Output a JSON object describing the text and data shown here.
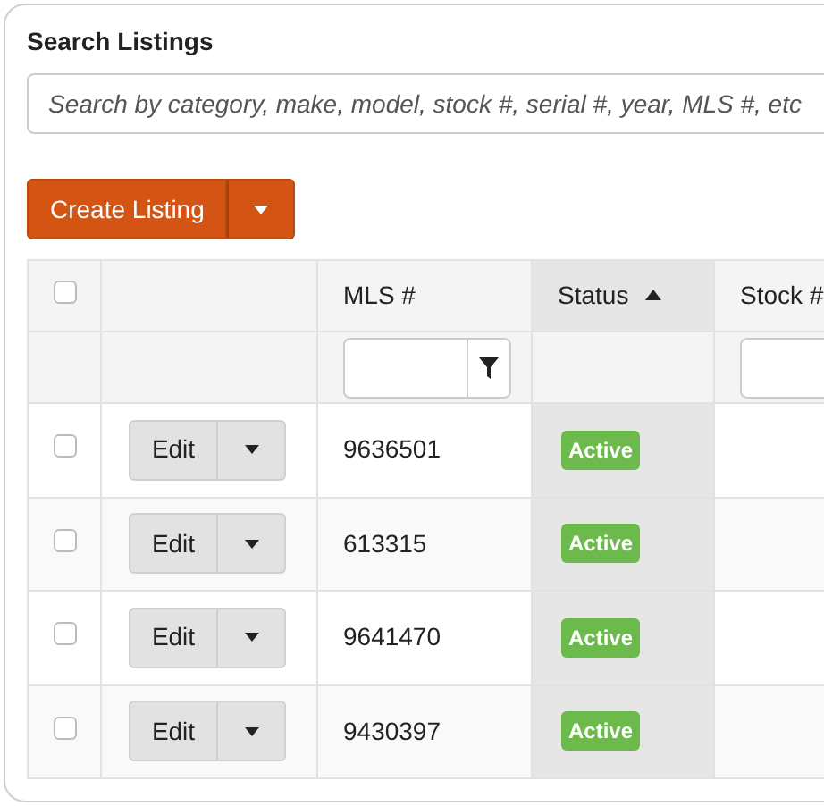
{
  "search": {
    "title": "Search Listings",
    "placeholder": "Search by category, make, model, stock #, serial #, year, MLS #, etc"
  },
  "create_button": {
    "label": "Create Listing"
  },
  "table": {
    "select_all": {
      "checked": false
    },
    "columns": [
      {
        "filter": false,
        "sorted": false
      },
      {
        "label": "MLS #",
        "filter": true,
        "filter_button": true,
        "sorted": false
      },
      {
        "label": "Status",
        "filter": false,
        "sorted": true
      },
      {
        "label": "Stock #",
        "filter": true,
        "filter_button": false,
        "sorted": false
      }
    ],
    "rows": [
      {
        "checked": false,
        "action": "Edit",
        "mls": "9636501",
        "status": "Active",
        "color": "#6cb94c"
      },
      {
        "checked": false,
        "action": "Edit",
        "mls": "613315",
        "status": "Active",
        "color": "#6cb94c"
      },
      {
        "checked": false,
        "action": "Edit",
        "mls": "9641470",
        "status": "Active",
        "color": "#6cb94c"
      },
      {
        "checked": false,
        "action": "Edit",
        "mls": "9430397",
        "status": "Active",
        "color": "#6cb94c"
      }
    ]
  }
}
